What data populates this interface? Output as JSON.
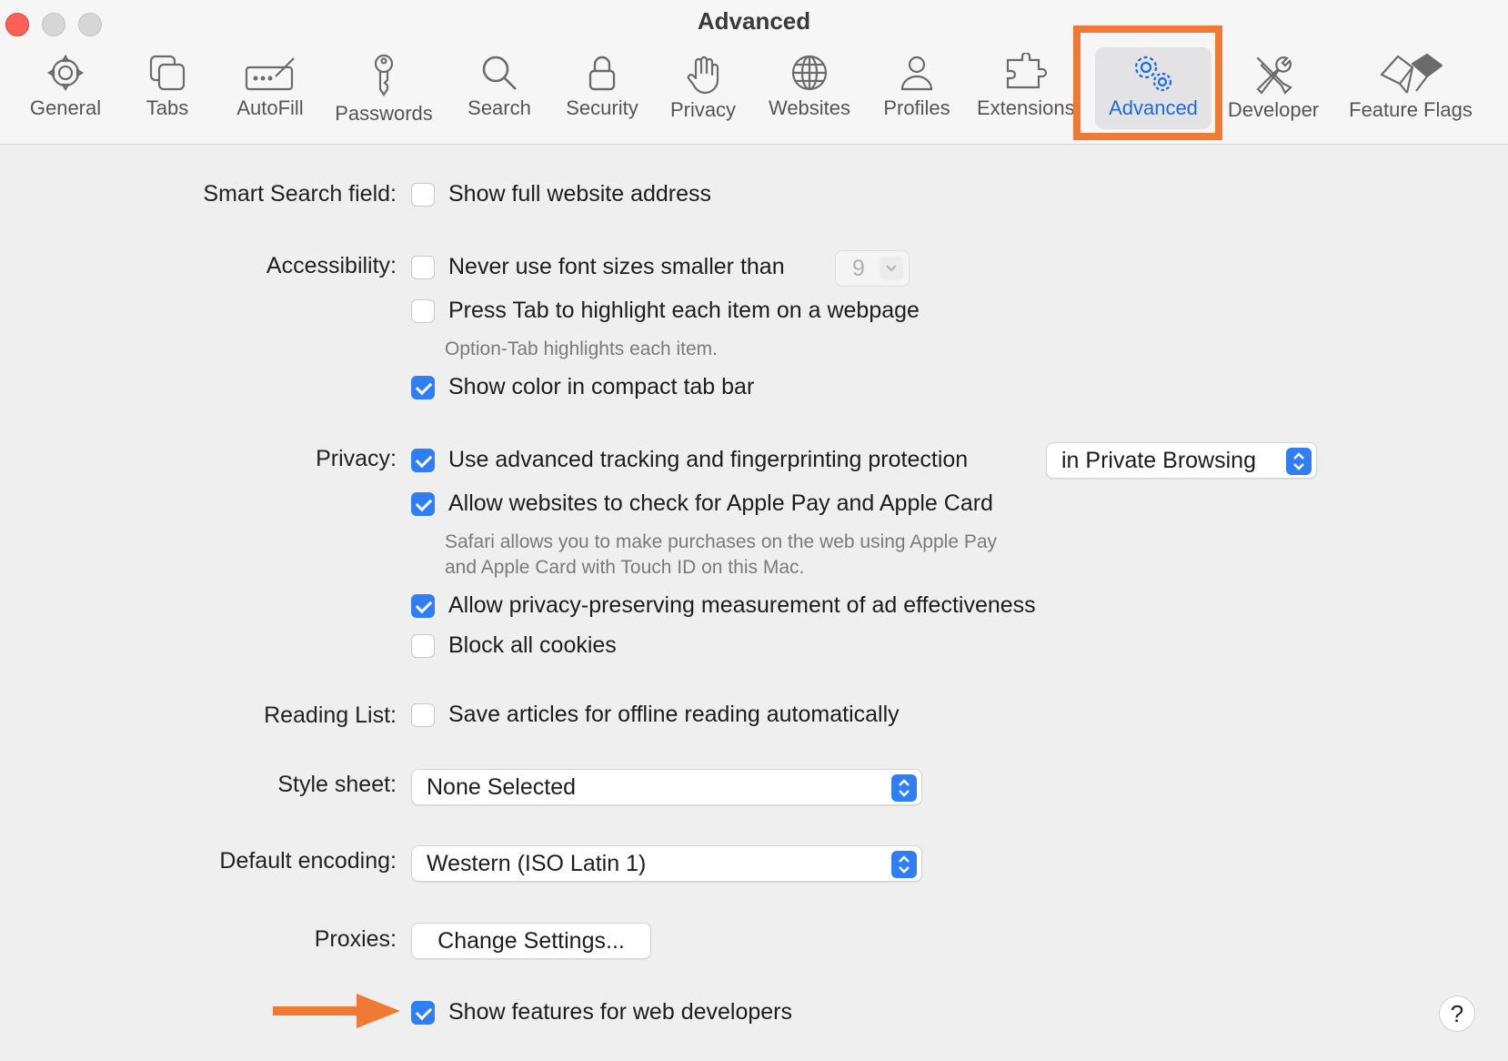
{
  "window": {
    "title": "Advanced"
  },
  "toolbar": {
    "items": [
      {
        "label": "General",
        "icon": "gear-icon"
      },
      {
        "label": "Tabs",
        "icon": "tabs-icon"
      },
      {
        "label": "AutoFill",
        "icon": "autofill-icon"
      },
      {
        "label": "Passwords",
        "icon": "key-icon"
      },
      {
        "label": "Search",
        "icon": "search-icon"
      },
      {
        "label": "Security",
        "icon": "lock-icon"
      },
      {
        "label": "Privacy",
        "icon": "hand-icon"
      },
      {
        "label": "Websites",
        "icon": "globe-icon"
      },
      {
        "label": "Profiles",
        "icon": "person-icon"
      },
      {
        "label": "Extensions",
        "icon": "puzzle-icon"
      },
      {
        "label": "Advanced",
        "icon": "gears-icon",
        "selected": true
      },
      {
        "label": "Developer",
        "icon": "tools-icon"
      },
      {
        "label": "Feature Flags",
        "icon": "flags-icon"
      }
    ],
    "accent_color": "#1a6be0",
    "highlight_color": "#f07a35"
  },
  "settings": {
    "smart_search": {
      "label": "Smart Search field:",
      "options": [
        {
          "text": "Show full website address",
          "checked": false
        }
      ]
    },
    "accessibility": {
      "label": "Accessibility:",
      "options": [
        {
          "text": "Never use font sizes smaller than",
          "checked": false
        },
        {
          "text": "Press Tab to highlight each item on a webpage",
          "checked": false
        },
        {
          "text": "Show color in compact tab bar",
          "checked": true
        }
      ],
      "font_size_value": "9",
      "note": "Option-Tab highlights each item."
    },
    "privacy": {
      "label": "Privacy:",
      "options": [
        {
          "text": "Use advanced tracking and fingerprinting protection",
          "checked": true
        },
        {
          "text": "Allow websites to check for Apple Pay and Apple Card",
          "checked": true
        },
        {
          "text": "Allow privacy-preserving measurement of ad effectiveness",
          "checked": true
        },
        {
          "text": "Block all cookies",
          "checked": false
        }
      ],
      "tracking_mode": "in Private Browsing",
      "note_line1": "Safari allows you to make purchases on the web using Apple Pay",
      "note_line2": "and Apple Card with Touch ID on this Mac."
    },
    "reading_list": {
      "label": "Reading List:",
      "options": [
        {
          "text": "Save articles for offline reading automatically",
          "checked": false
        }
      ]
    },
    "style_sheet": {
      "label": "Style sheet:",
      "value": "None Selected"
    },
    "default_encoding": {
      "label": "Default encoding:",
      "value": "Western (ISO Latin 1)"
    },
    "proxies": {
      "label": "Proxies:",
      "button": "Change Settings..."
    },
    "web_developers": {
      "options": [
        {
          "text": "Show features for web developers",
          "checked": true
        }
      ]
    }
  },
  "help": {
    "label": "?"
  },
  "colors": {
    "checkbox_on": "#2f7ef5",
    "annotation_arrow": "#f07a35"
  }
}
